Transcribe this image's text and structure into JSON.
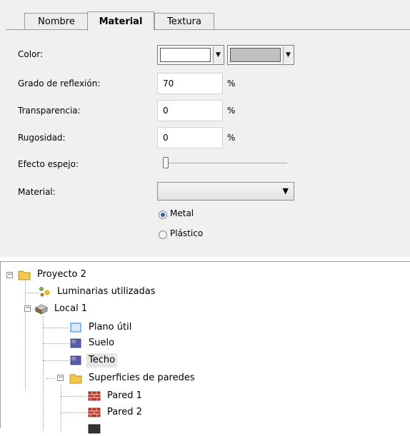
{
  "tabs": [
    {
      "label": "Nombre",
      "active": false
    },
    {
      "label": "Material",
      "active": true
    },
    {
      "label": "Textura",
      "active": false
    }
  ],
  "form": {
    "color_label": "Color:",
    "color_primary": "#ffffff",
    "color_secondary": "#c0c0c0",
    "reflexion_label": "Grado de reflexión:",
    "reflexion_value": "70",
    "transparencia_label": "Transparencia:",
    "transparencia_value": "0",
    "rugosidad_label": "Rugosidad:",
    "rugosidad_value": "0",
    "percent": "%",
    "espejo_label": "Efecto espejo:",
    "espejo_level": 0,
    "material_label": "Material:",
    "material_value": "",
    "radio_metal": "Metal",
    "radio_plastico": "Plástico",
    "selected_material_type": "Metal"
  },
  "tree": {
    "proyecto": "Proyecto 2",
    "luminarias": "Luminarias utilizadas",
    "local": "Local 1",
    "plano": "Plano útil",
    "suelo": "Suelo",
    "techo": "Techo",
    "superficies": "Superficies de paredes",
    "pared1": "Pared 1",
    "pared2": "Pared 2"
  },
  "colors": {
    "accent": "#2c62b5",
    "folder": "#f2c94c",
    "wall": "#c0392b",
    "surface": "#5a5aa8"
  }
}
